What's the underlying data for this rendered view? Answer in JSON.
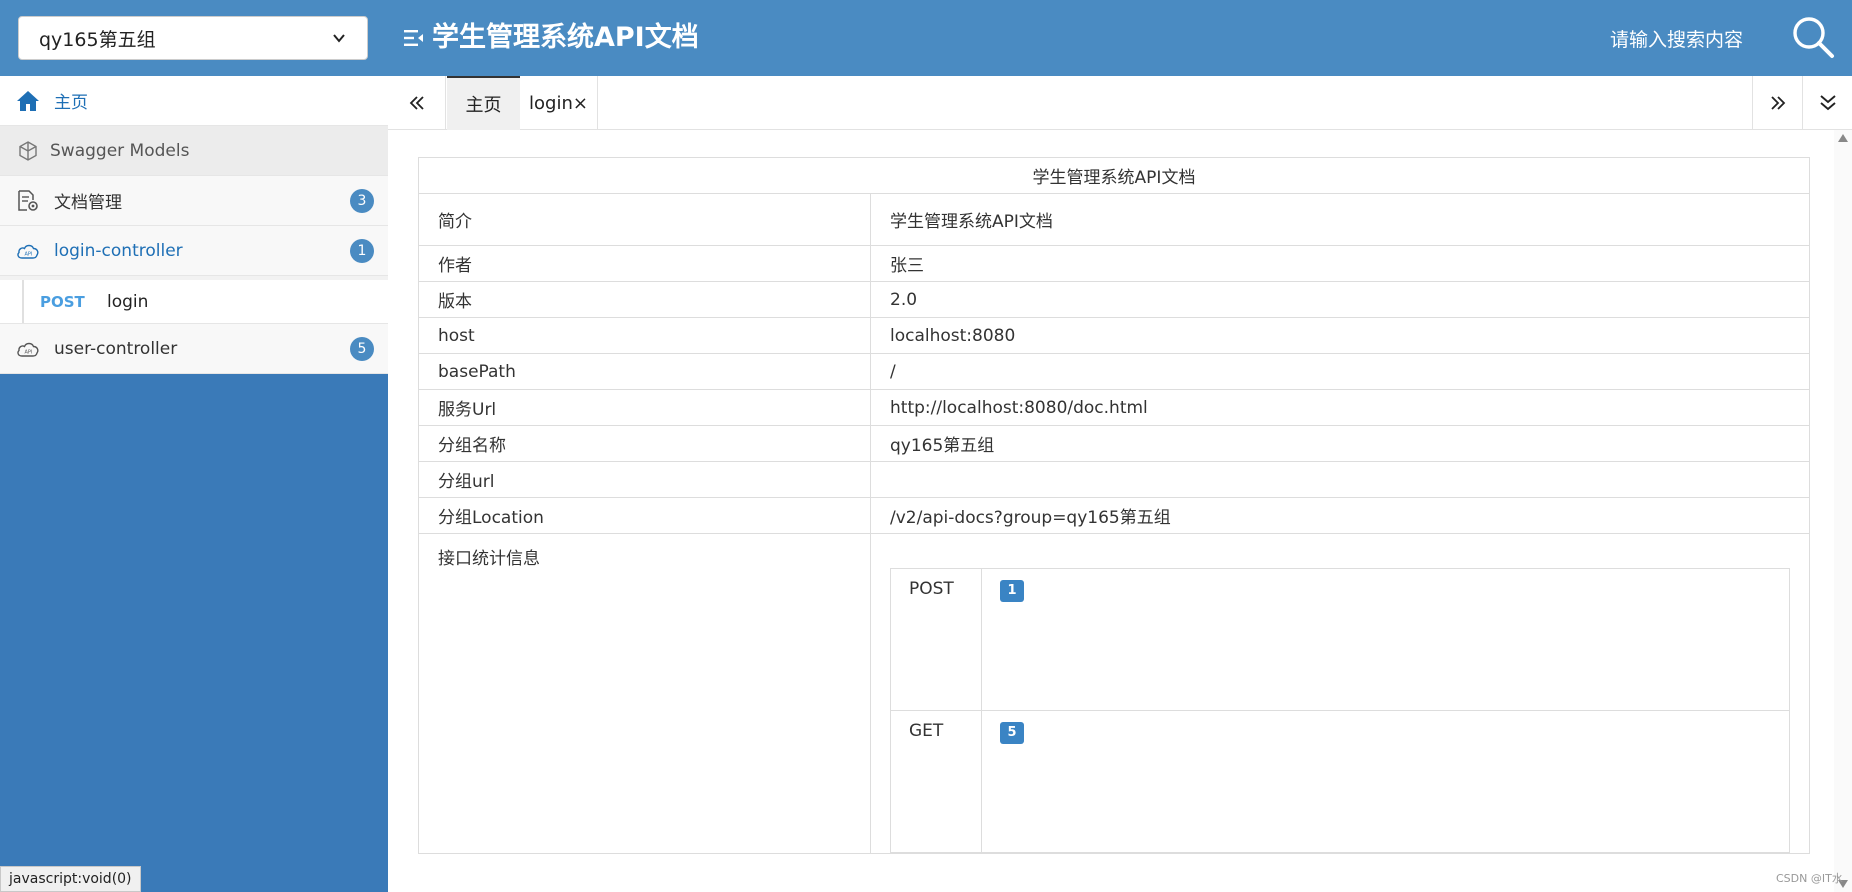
{
  "header": {
    "group_value": "qy165第五组",
    "title": "学生管理系统API文档",
    "search_placeholder": "请输入搜索内容"
  },
  "sidebar": {
    "items": [
      {
        "label": "主页",
        "icon": "home-icon"
      },
      {
        "label": "Swagger Models",
        "icon": "models-icon"
      },
      {
        "label": "文档管理",
        "icon": "doc-settings-icon",
        "badge": "3"
      },
      {
        "label": "login-controller",
        "icon": "cloud-api-icon",
        "badge": "1"
      },
      {
        "label": "user-controller",
        "icon": "cloud-api-icon",
        "badge": "5"
      }
    ],
    "sub_item": {
      "method": "POST",
      "path": "login"
    }
  },
  "tabs": {
    "home": "主页",
    "login": "login",
    "login_close": "×"
  },
  "doc": {
    "title": "学生管理系统API文档",
    "rows": [
      {
        "key": "简介",
        "value": "学生管理系统API文档"
      },
      {
        "key": "作者",
        "value": "张三"
      },
      {
        "key": "版本",
        "value": "2.0"
      },
      {
        "key": "host",
        "value": "localhost:8080"
      },
      {
        "key": "basePath",
        "value": "/"
      },
      {
        "key": "服务Url",
        "value": "http://localhost:8080/doc.html"
      },
      {
        "key": "分组名称",
        "value": "qy165第五组"
      },
      {
        "key": "分组url",
        "value": ""
      },
      {
        "key": "分组Location",
        "value": "/v2/api-docs?group=qy165第五组"
      }
    ],
    "stats_label": "接口统计信息",
    "stats": [
      {
        "method": "POST",
        "count": "1"
      },
      {
        "method": "GET",
        "count": "5"
      }
    ]
  },
  "status_tip": "javascript:void(0)",
  "watermark": "CSDN @IT水",
  "colors": {
    "header_bg": "#4a8bc2",
    "sidebar_bg": "#3a7ab8",
    "accent_text": "#1e6fb5",
    "badge_bg": "#4a8bc2",
    "post_method": "#4a9ee0"
  }
}
